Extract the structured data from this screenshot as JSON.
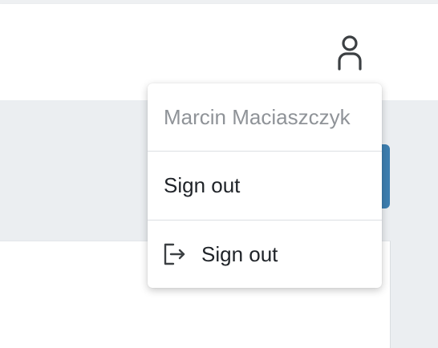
{
  "header": {
    "user_icon": "user-icon"
  },
  "user_menu": {
    "user_name": "Marcin Maciaszczyk",
    "items": [
      {
        "label": "Sign out"
      },
      {
        "label": "Sign out",
        "icon": "sign-out-icon"
      }
    ]
  },
  "colors": {
    "header_bg": "#ffffff",
    "page_bg": "#ebeef1",
    "accent_blue": "#3d7eb0",
    "muted_text": "#8f9398",
    "text": "#1f2328"
  }
}
